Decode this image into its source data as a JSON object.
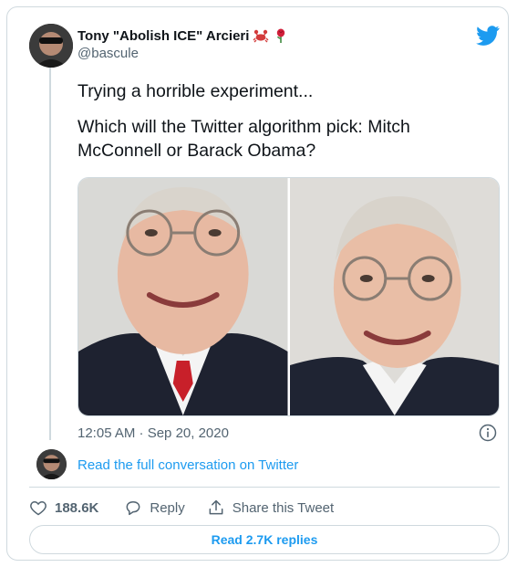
{
  "author": {
    "display_name": "Tony \"Abolish ICE\" Arcieri",
    "emojis": [
      "crab-emoji",
      "rose-emoji"
    ],
    "handle": "@bascule"
  },
  "tweet": {
    "text_line1": "Trying a horrible experiment...",
    "text_line2": "Which will the Twitter algorithm pick: Mitch McConnell or Barack Obama?",
    "timestamp": "12:05 AM · Sep 20, 2020"
  },
  "conversation_link": "Read the full conversation on Twitter",
  "actions": {
    "likes": "188.6K",
    "reply": "Reply",
    "share": "Share this Tweet"
  },
  "read_replies": "Read 2.7K replies",
  "colors": {
    "accent": "#1d9bf0",
    "secondary_text": "#536471",
    "border": "#cfd9de"
  }
}
